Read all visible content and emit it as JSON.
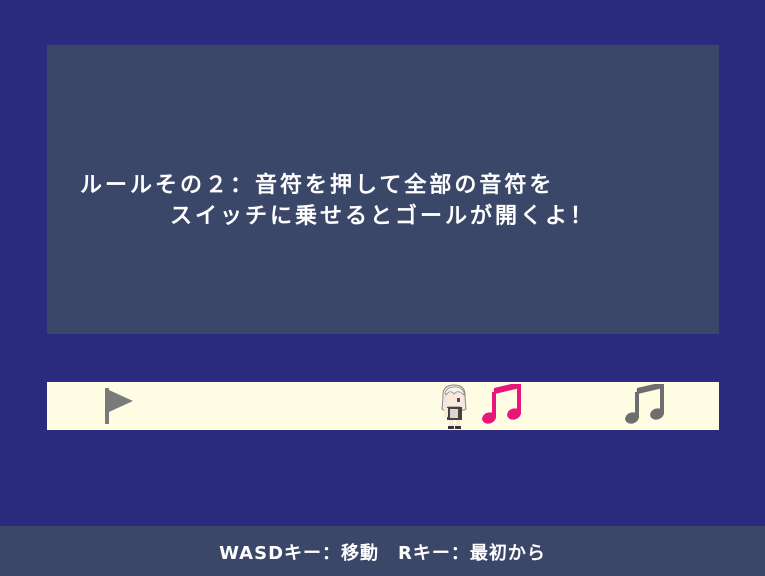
{
  "dialog": {
    "line1": "ルールその２：音符を押して全部の音符を",
    "line2": "スイッチに乗せるとゴールが開くよ！"
  },
  "stage": {
    "objects": [
      {
        "kind": "goal-flag",
        "color": "#7a7a7a"
      },
      {
        "kind": "player-character"
      },
      {
        "kind": "music-note",
        "color": "#e8157a"
      },
      {
        "kind": "music-note",
        "color": "#6e6e6e"
      }
    ]
  },
  "controls_hint": "WASDキー：移動　Rキー：最初から",
  "colors": {
    "background": "#2a2a7f",
    "panel": "#3b4768",
    "stage_floor": "#fefde4",
    "note_active": "#e8157a",
    "note_inactive": "#6e6e6e"
  }
}
